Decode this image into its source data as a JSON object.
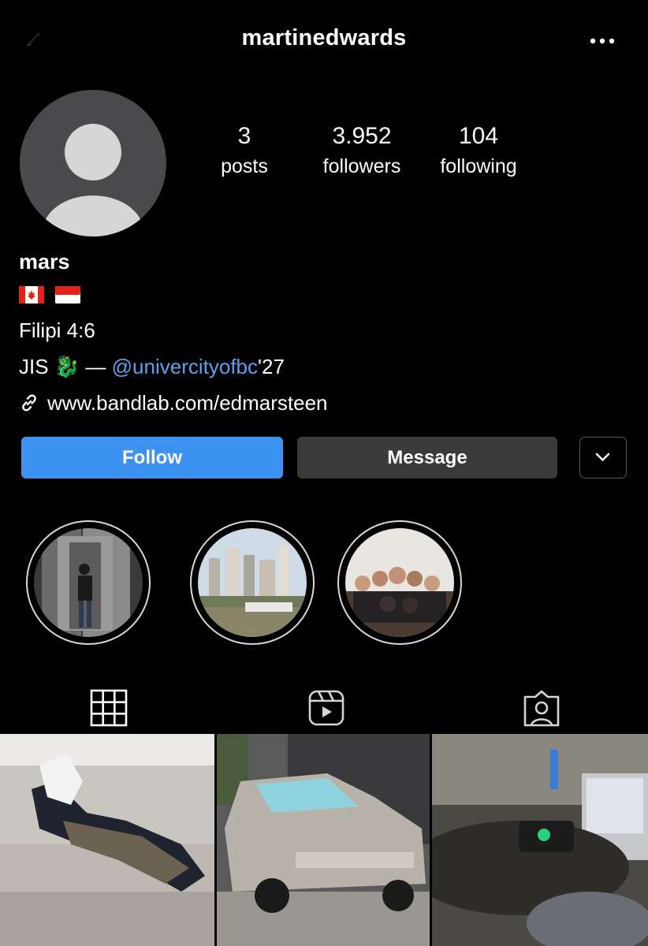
{
  "header": {
    "username": "martinedwards",
    "back_icon": "back-arrow-icon",
    "more_icon": "more-options-icon"
  },
  "profile": {
    "avatar_icon": "default-avatar-icon",
    "stats": [
      {
        "value": "3",
        "label": "posts"
      },
      {
        "value": "3.952",
        "label": "followers"
      },
      {
        "value": "104",
        "label": "following"
      }
    ]
  },
  "bio": {
    "name": "mars",
    "flags": [
      "canada-flag-icon",
      "indonesia-flag-icon"
    ],
    "line1": "Filipi 4:6",
    "line2_prefix": "JIS",
    "line2_emoji": "🐉",
    "line2_dash": "—",
    "mention": "@univercityofbc",
    "line2_suffix": "'27",
    "link": "www.bandlab.com/edmarsteen"
  },
  "actions": {
    "follow_label": "Follow",
    "message_label": "Message",
    "dropdown_icon": "chevron-down-icon"
  },
  "highlights": [
    {
      "image": "elevator-mirror-selfie"
    },
    {
      "image": "city-skyline-waterfront"
    },
    {
      "image": "group-party-photo"
    }
  ],
  "tabs": [
    {
      "icon": "grid-icon",
      "active": true
    },
    {
      "icon": "reels-icon",
      "active": false
    },
    {
      "icon": "tagged-icon",
      "active": false
    }
  ],
  "posts": [
    {
      "image": "person-on-couch"
    },
    {
      "image": "silver-sedan-car"
    },
    {
      "image": "music-studio-desk"
    }
  ],
  "colors": {
    "background": "#000000",
    "follow_button": "#3d91f1",
    "message_button": "#3a3a3a",
    "mention_link": "#5aa2ee"
  }
}
